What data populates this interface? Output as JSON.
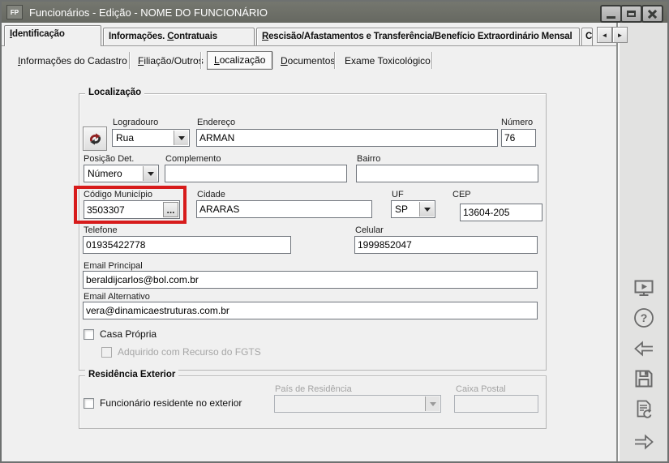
{
  "window": {
    "title": "Funcionários - Edição - NOME DO FUNCIONÁRIO",
    "icon_label": "FP"
  },
  "main_tabs": {
    "active": "Identificação",
    "items": [
      {
        "pre": "",
        "accel": "I",
        "post": "dentificação"
      },
      {
        "pre": "Informações. ",
        "accel": "C",
        "post": "ontratuais"
      },
      {
        "pre": "",
        "accel": "R",
        "post": "escisão/Afastamentos e Transferência/Benefício Extraordinário Mensal"
      }
    ],
    "clipped_tab": "C",
    "scroll_left_glyph": "◄",
    "scroll_right_glyph": "►"
  },
  "sub_tabs": {
    "active": "Localização",
    "items": [
      {
        "pre": "",
        "accel": "I",
        "post": "nformações do Cadastro"
      },
      {
        "pre": "",
        "accel": "F",
        "post": "iliação/Outros"
      },
      {
        "pre": "",
        "accel": "L",
        "post": "ocalização"
      },
      {
        "pre": "",
        "accel": "D",
        "post": "ocumentos"
      },
      {
        "pre": "Exame Toxicológico",
        "accel": "",
        "post": ""
      }
    ]
  },
  "localizacao": {
    "group_label": "Localização",
    "logradouro_label": "Logradouro",
    "logradouro_value": "Rua",
    "endereco_label": "Endereço",
    "endereco_value": "ARMAN",
    "numero_label": "Número",
    "numero_value": "76",
    "posicao_label": "Posição Det.",
    "posicao_value": "Número",
    "complemento_label": "Complemento",
    "complemento_value": "",
    "bairro_label": "Bairro",
    "bairro_value": "",
    "codigo_municipio_label": "Código Município",
    "codigo_municipio_value": "3503307",
    "ellipsis_label": "...",
    "cidade_label": "Cidade",
    "cidade_value": "ARARAS",
    "uf_label": "UF",
    "uf_value": "SP",
    "cep_label": "CEP",
    "cep_value": "13604-205",
    "telefone_label": "Telefone",
    "telefone_value": "01935422778",
    "celular_label": "Celular",
    "celular_value": "1999852047",
    "email_principal_label": "Email Principal",
    "email_principal_value": "beraldijcarlos@bol.com.br",
    "email_alternativo_label": "Email Alternativo",
    "email_alternativo_value": "vera@dinamicaestruturas.com.br",
    "casa_propria_label": "Casa Própria",
    "casa_propria_checked": false,
    "fgts_label": "Adquirido com Recurso do FGTS",
    "fgts_checked": false,
    "fgts_disabled": true
  },
  "residencia_exterior": {
    "group_label": "Residência Exterior",
    "residente_label": "Funcionário residente no exterior",
    "residente_checked": false,
    "pais_label": "País de Residência",
    "pais_value": "",
    "caixa_postal_label": "Caixa Postal",
    "caixa_postal_value": ""
  },
  "annotation": {
    "highlight_color": "#d71b1b"
  },
  "side_toolbar": {
    "icons": [
      "video-player-icon",
      "help-icon",
      "back-arrow-icon",
      "save-icon",
      "document-refresh-icon",
      "forward-arrow-icon"
    ]
  }
}
